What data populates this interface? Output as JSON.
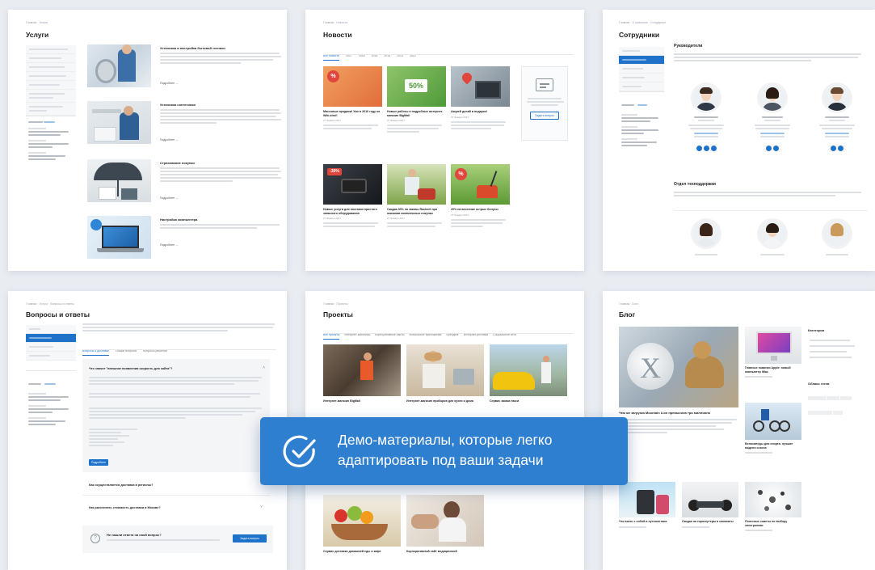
{
  "banner": {
    "line1": "Демо-материалы, которые легко",
    "line2": "адаптировать под ваши задачи",
    "icon": "checkmark-circle-icon"
  },
  "services": {
    "title": "Услуги",
    "more": "Подробнее →",
    "items": [
      {
        "title": "Установка и настройка бытовой техники"
      },
      {
        "title": "Установка сантехники"
      },
      {
        "title": "Страхование покупки"
      },
      {
        "title": "Настройка компьютера"
      }
    ]
  },
  "news": {
    "title": "Новости",
    "tabs": [
      "Все новости",
      "2017",
      "2016",
      "2015",
      "2014",
      "2013",
      "2012"
    ],
    "badges": [
      "%",
      "50%",
      "%",
      "-30%",
      "%",
      "%"
    ],
    "items": [
      {
        "title": "Массовые продажи! Уже в 2016 году на Wiki-stroi!"
      },
      {
        "title": "Новые работы и подробные интернет-магазин BigMall"
      },
      {
        "title": "Акцией делай в подарок!"
      },
      {
        "title": "Новые услуги для поставок простого запасного оборудования"
      },
      {
        "title": "Скидка 30% на заказы Racknet при оказании комплексных покупки"
      },
      {
        "title": "20% на весенние острые бонусы"
      }
    ],
    "date": "27 Января 2017",
    "subscribe_button": "Задать вопрос"
  },
  "staff": {
    "title": "Сотрудники",
    "section1": "Руководители",
    "section2": "Отдел техподдержки"
  },
  "faq": {
    "title": "Вопросы и ответы",
    "tabs": [
      "Вопросы о доставке",
      "Общие вопросы",
      "Вопросы решений"
    ],
    "q1": "Что значит \"внешние появления скорость для сайта\"?",
    "q2": "Как осуществляется доставка в регионы?",
    "q3": "Как рассчитать стоимость доставки в Москве?",
    "ask_title": "Не нашли ответа на свой вопрос?",
    "ask_button": "Задать вопрос",
    "more_button": "Подробнее"
  },
  "projects": {
    "title": "Проекты",
    "tabs": [
      "Все проекты",
      "Интернет-магазины",
      "Корпоративные сайты",
      "Мобильные приложения",
      "Брендинг",
      "Интернет-реклама",
      "Социальные сети"
    ],
    "items": [
      {
        "title": "Интернет-магазин BigMall"
      },
      {
        "title": "Интернет-магазин приборов для кухни и дома"
      },
      {
        "title": "Сервис заказа такси"
      },
      {
        "title": "Сервис доставки домашней еды и кафе"
      },
      {
        "title": "Корпоративный сайт медицинской"
      }
    ]
  },
  "blog": {
    "title": "Блог",
    "categories": "Категории",
    "tags": "Облако тегов",
    "featured": "Чем же загрузка Mountain Lion превысила три миллиона",
    "items": [
      {
        "title": "Главные новинки Apple: новый компьютер iMac"
      },
      {
        "title": "Велосипеды для спорта: лучшие модели сезона"
      },
      {
        "title": "Что взять с собой в путешествие"
      },
      {
        "title": "Скидки на гироскутеры и самокаты"
      },
      {
        "title": "Полезные советы по выбору электроники"
      }
    ]
  },
  "colors": {
    "accent": "#1e72c9",
    "banner": "#2f7fd0",
    "badge": "#e0463c",
    "background": "#e9edf2"
  }
}
